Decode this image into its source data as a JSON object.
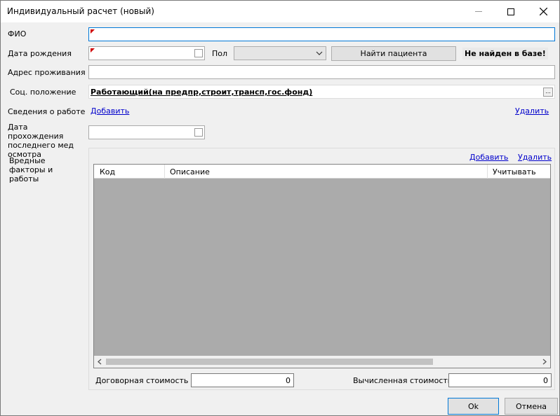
{
  "window": {
    "title": "Индивидуальный расчет (новый)"
  },
  "form": {
    "fio_label": "ФИО",
    "birthdate_label": "Дата рождения",
    "sex_label": "Пол",
    "find_patient_button": "Найти пациента",
    "not_found_text": "Не найден в базе!",
    "address_label": "Адрес проживания",
    "social_label": "Соц. положение",
    "social_value": "Работающий(на предпр,строит,трансп,гос.фонд)",
    "work_label": "Сведения о работе",
    "work_add_link": "Добавить",
    "work_remove_link": "Удалить",
    "last_exam_label": "Дата прохождения последнего мед осмотра",
    "hazard_label": "Вредные факторы и работы"
  },
  "hazards": {
    "add_link": "Добавить",
    "remove_link": "Удалить",
    "columns": [
      "Код",
      "Описание",
      "Учитывать"
    ]
  },
  "costs": {
    "contract_label": "Договорная стоимость",
    "contract_value": "0",
    "calculated_label": "Вычисленная стоимость",
    "calculated_value": "0"
  },
  "footer": {
    "ok_button": "Ok",
    "cancel_button": "Отмена"
  }
}
